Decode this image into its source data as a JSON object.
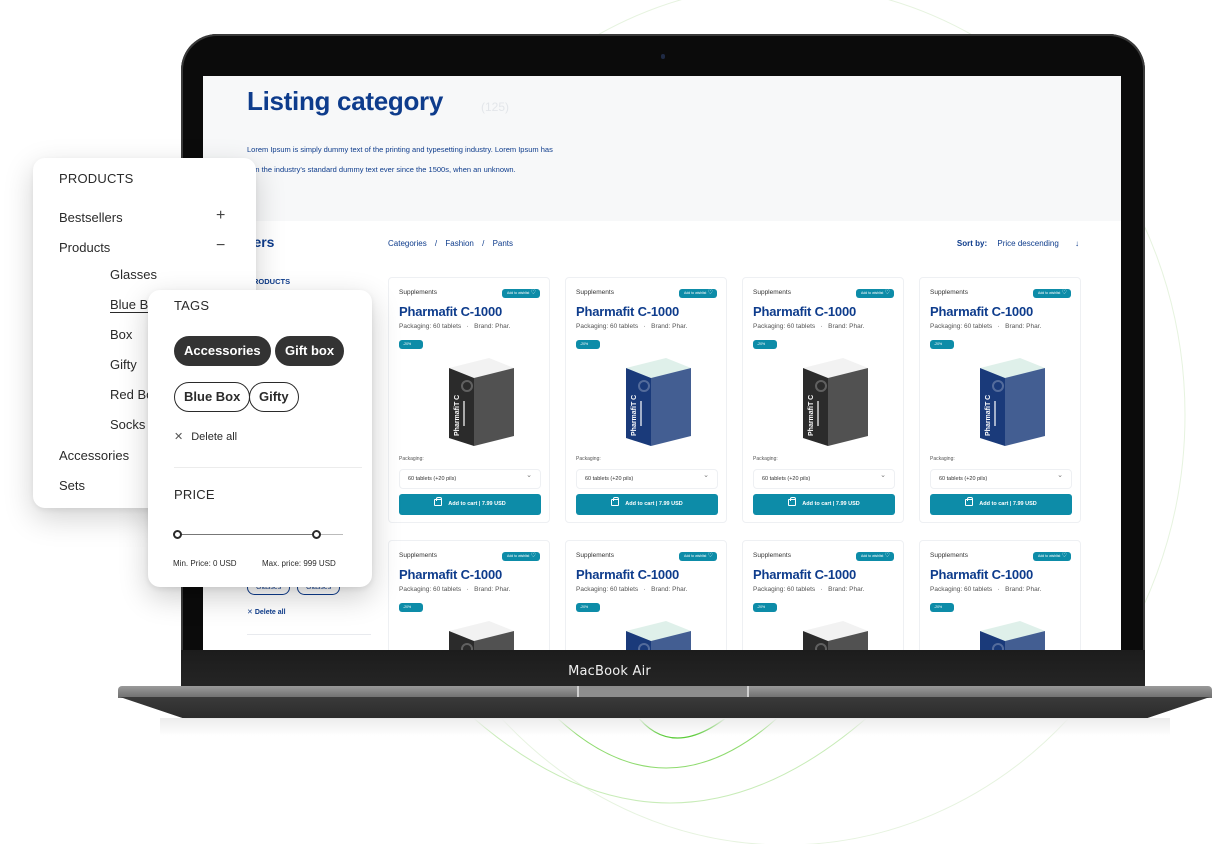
{
  "device": {
    "label": "MacBook Air"
  },
  "page": {
    "title": "Listing category",
    "count": "(125)",
    "description_line1": "Lorem Ipsum is simply dummy text of the printing and typesetting industry. Lorem Ipsum has",
    "description_line2": "een the industry's standard dummy text ever since the 1500s, when an unknown."
  },
  "filters": {
    "title": "ilters",
    "section": "RODUCTS",
    "bg_tags": [
      "Glasses",
      "Glasses"
    ],
    "delete_all": "Delete all"
  },
  "breadcrumb": [
    "Categories",
    "/",
    "Fashion",
    "/",
    "Pants"
  ],
  "sort": {
    "label": "Sort by:",
    "value": "Price descending",
    "arrow": "↓"
  },
  "products": [
    {
      "category": "Supplements",
      "wishlist": "Add to wishlist",
      "name": "Pharmafit C-1000",
      "packaging": "Packaging: 60 tablets",
      "separator": "·",
      "brand": "Brand: Phar.",
      "badge": "-20%",
      "box_color": "dark",
      "pack_label": "Packaging:",
      "pack_value": "60 tablets (+20 pils)",
      "cart": "Add to cart | 7.99 USD"
    },
    {
      "category": "Supplements",
      "wishlist": "Add to wishlist",
      "name": "Pharmafit C-1000",
      "packaging": "Packaging: 60 tablets",
      "separator": "·",
      "brand": "Brand: Phar.",
      "badge": "-20%",
      "box_color": "blue",
      "pack_label": "Packaging:",
      "pack_value": "60 tablets (+20 pils)",
      "cart": "Add to cart | 7.99 USD"
    },
    {
      "category": "Supplements",
      "wishlist": "Add to wishlist",
      "name": "Pharmafit C-1000",
      "packaging": "Packaging: 60 tablets",
      "separator": "·",
      "brand": "Brand: Phar.",
      "badge": "-20%",
      "box_color": "dark",
      "pack_label": "Packaging:",
      "pack_value": "60 tablets (+20 pils)",
      "cart": "Add to cart | 7.99 USD"
    },
    {
      "category": "Supplements",
      "wishlist": "Add to wishlist",
      "name": "Pharmafit C-1000",
      "packaging": "Packaging: 60 tablets",
      "separator": "·",
      "brand": "Brand: Phar.",
      "badge": "-20%",
      "box_color": "blue",
      "pack_label": "Packaging:",
      "pack_value": "60 tablets (+20 pils)",
      "cart": "Add to cart | 7.99 USD"
    },
    {
      "category": "Supplements",
      "wishlist": "Add to wishlist",
      "name": "Pharmafit C-1000",
      "packaging": "Packaging: 60 tablets",
      "separator": "·",
      "brand": "Brand: Phar.",
      "badge": "-20%",
      "box_color": "dark"
    },
    {
      "category": "Supplements",
      "wishlist": "Add to wishlist",
      "name": "Pharmafit C-1000",
      "packaging": "Packaging: 60 tablets",
      "separator": "·",
      "brand": "Brand: Phar.",
      "badge": "-20%",
      "box_color": "blue"
    },
    {
      "category": "Supplements",
      "wishlist": "Add to wishlist",
      "name": "Pharmafit C-1000",
      "packaging": "Packaging: 60 tablets",
      "separator": "·",
      "brand": "Brand: Phar.",
      "badge": "-20%",
      "box_color": "dark"
    },
    {
      "category": "Supplements",
      "wishlist": "Add to wishlist",
      "name": "Pharmafit C-1000",
      "packaging": "Packaging: 60 tablets",
      "separator": "·",
      "brand": "Brand: Phar.",
      "badge": "-20%",
      "box_color": "blue"
    }
  ],
  "box_text": "PharmafiT C",
  "products_panel": {
    "heading": "PRODUCTS",
    "items": [
      {
        "label": "Bestsellers",
        "level": "top",
        "toggle": "+"
      },
      {
        "label": "Products",
        "level": "top",
        "toggle": "−"
      },
      {
        "label": "Glasses",
        "level": "sub"
      },
      {
        "label": "Blue Box",
        "level": "sub",
        "active": true
      },
      {
        "label": "Box",
        "level": "sub"
      },
      {
        "label": "Gifty",
        "level": "sub"
      },
      {
        "label": "Red Box",
        "level": "sub"
      },
      {
        "label": "Socks",
        "level": "sub"
      },
      {
        "label": "Accessories",
        "level": "top"
      },
      {
        "label": "Sets",
        "level": "top"
      }
    ]
  },
  "tags_panel": {
    "heading": "TAGS",
    "selected": [
      "Accessories",
      "Gift box"
    ],
    "unselected": [
      "Blue Box",
      "Gifty"
    ],
    "delete_all": "Delete all",
    "price_heading": "PRICE",
    "price_min": 0,
    "price_max": 999,
    "range_low_fraction": 0.0,
    "range_high_fraction": 0.84,
    "min_label": "Min. Price: 0 USD",
    "max_label": "Max. price: 999 USD"
  },
  "colors": {
    "brand_blue": "#0e3c8c",
    "accent_teal": "#0d8ca8",
    "chip_dark": "#333333",
    "box_dark": "#2b2b2b",
    "box_blue": "#1a3a7a",
    "arc_green": "#5ccc3a"
  }
}
